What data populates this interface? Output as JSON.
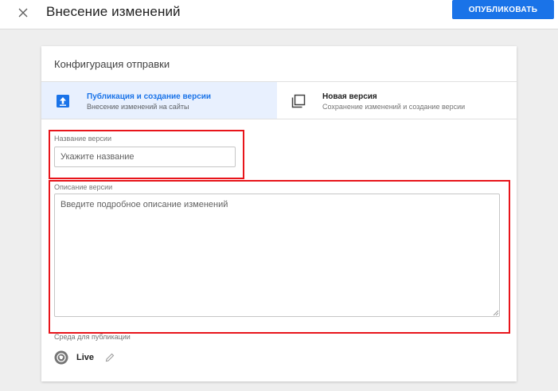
{
  "header": {
    "title": "Внесение изменений",
    "publish_label": "ОПУБЛИКОВАТЬ",
    "close_icon": "close-icon"
  },
  "card": {
    "title": "Конфигурация отправки",
    "options": [
      {
        "title": "Публикация и создание версии",
        "subtitle": "Внесение изменений на сайты",
        "icon": "publish-icon",
        "selected": true
      },
      {
        "title": "Новая версия",
        "subtitle": "Сохранение изменений и создание версии",
        "icon": "new-version-icon",
        "selected": false
      }
    ],
    "version_name": {
      "label": "Название версии",
      "placeholder": "Укажите название",
      "value": ""
    },
    "version_description": {
      "label": "Описание версии",
      "placeholder": "Введите подробное описание изменений",
      "value": ""
    },
    "environment": {
      "label": "Среда для публикации",
      "value": "Live",
      "icon": "environment-icon",
      "edit_icon": "pencil-icon"
    }
  },
  "colors": {
    "accent": "#1a73e8",
    "selected_bg": "#e8f0fe",
    "highlight": "#e8151b"
  }
}
